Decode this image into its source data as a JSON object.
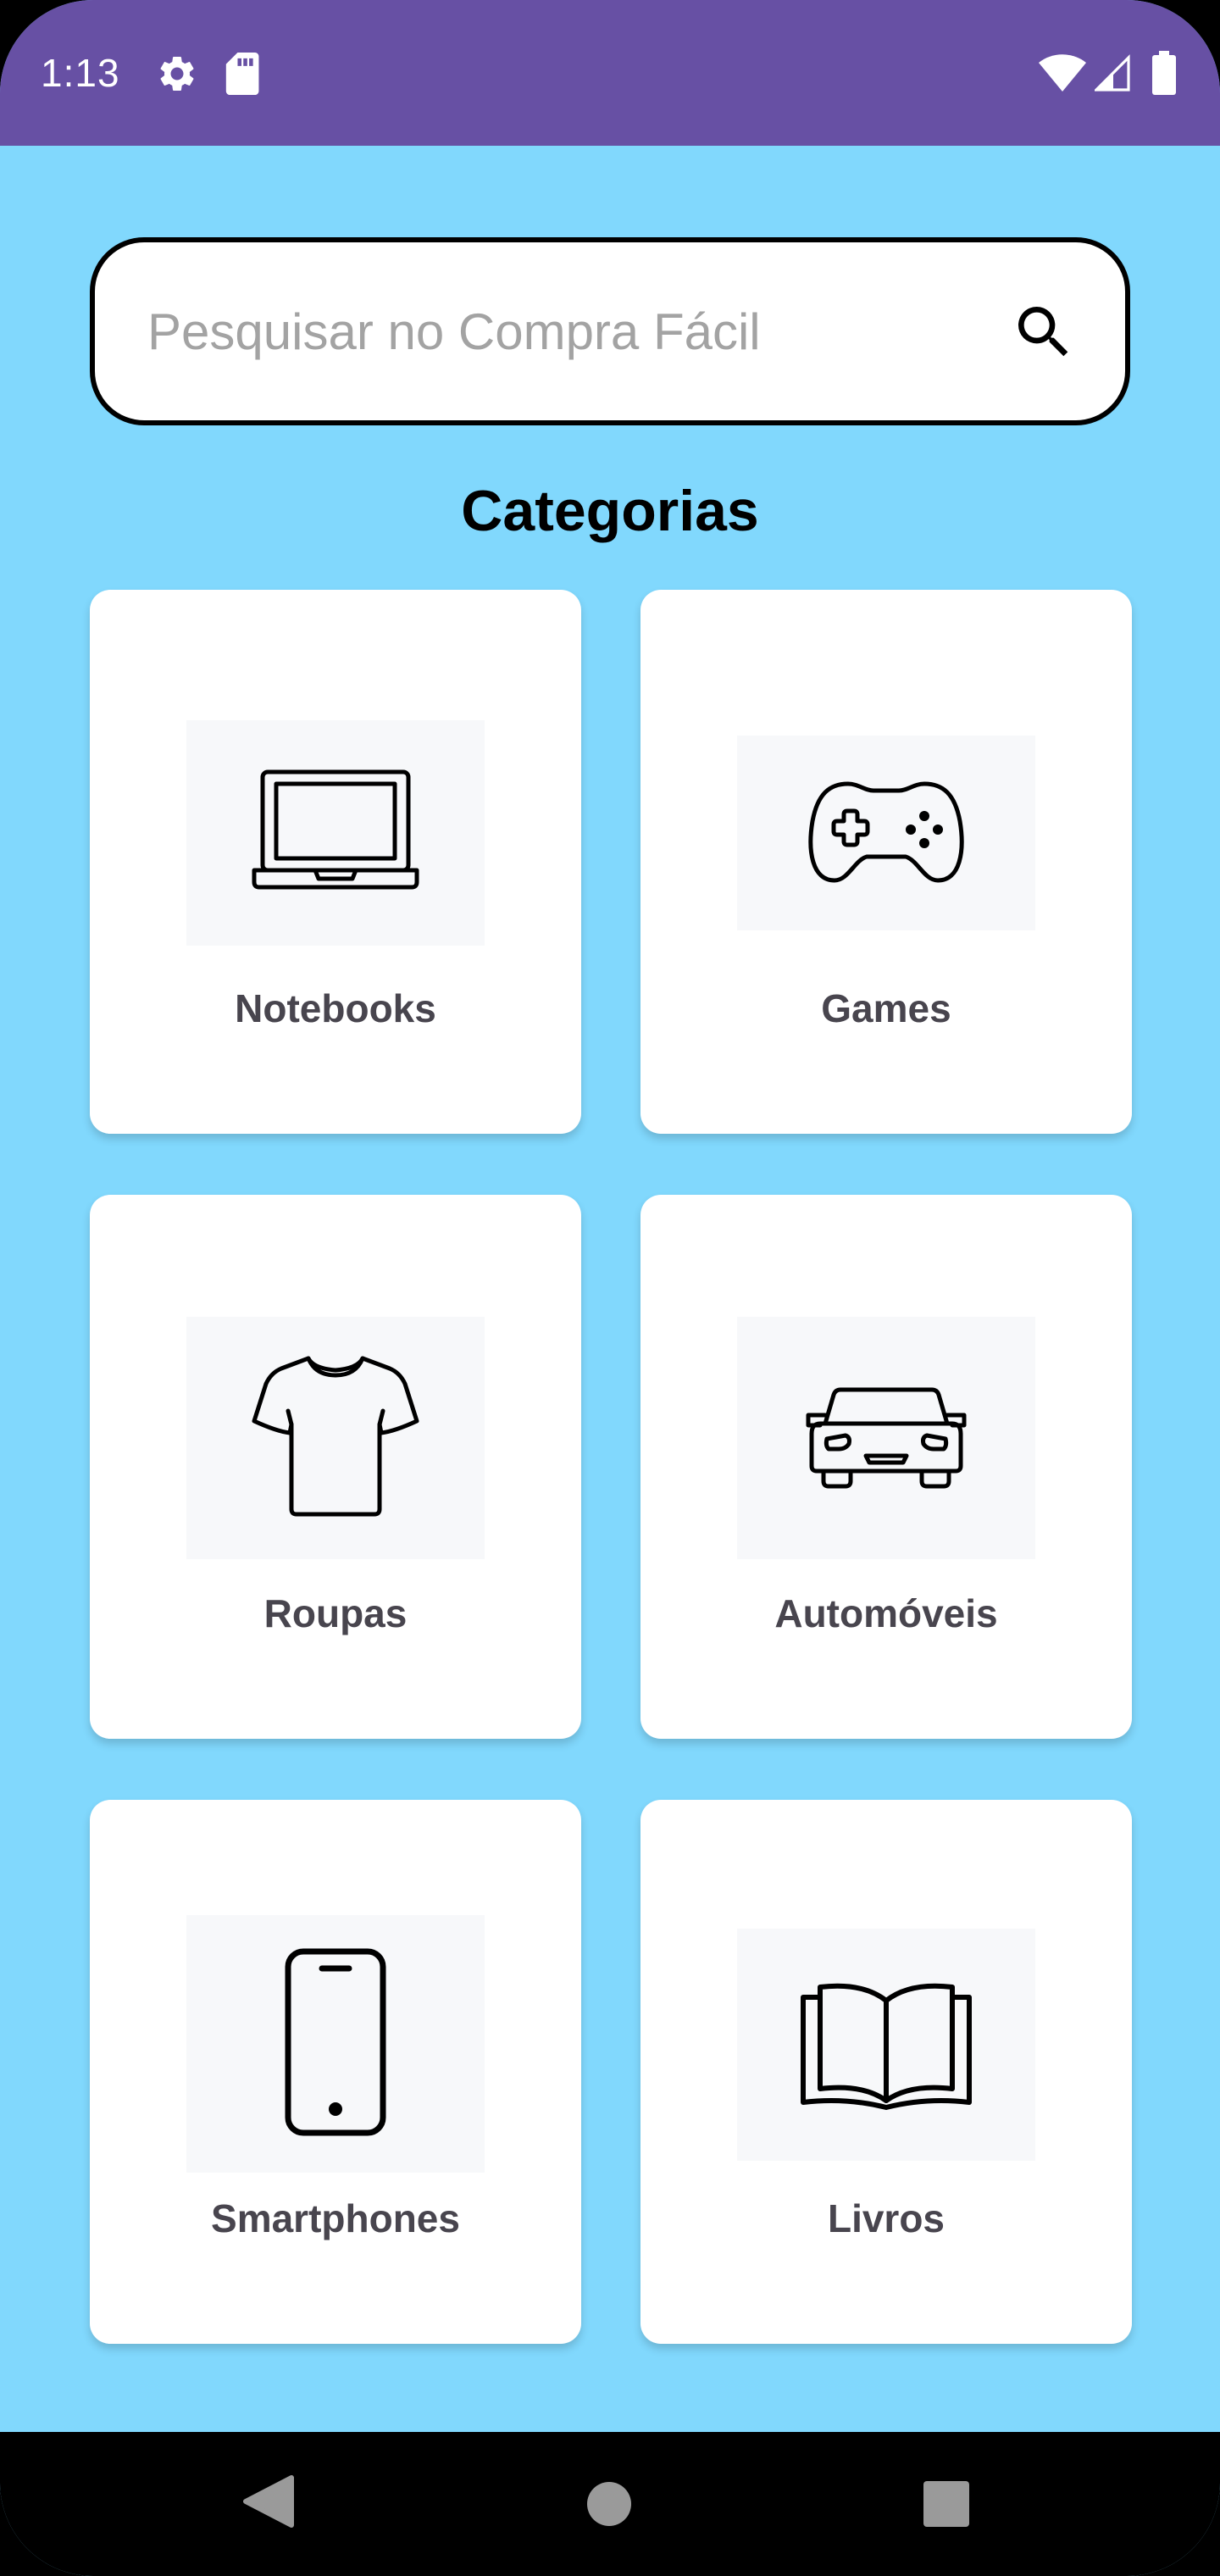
{
  "status_bar": {
    "time": "1:13",
    "icons": [
      "gear-icon",
      "sd-card-icon",
      "wifi-icon",
      "signal-icon",
      "battery-icon"
    ]
  },
  "search": {
    "placeholder": "Pesquisar no Compra Fácil",
    "value": "",
    "icon": "search-icon"
  },
  "page": {
    "title": "Categorias"
  },
  "categories": [
    {
      "label": "Notebooks",
      "icon": "laptop-icon"
    },
    {
      "label": "Games",
      "icon": "gamepad-icon"
    },
    {
      "label": "Roupas",
      "icon": "tshirt-icon"
    },
    {
      "label": "Automóveis",
      "icon": "car-icon"
    },
    {
      "label": "Smartphones",
      "icon": "smartphone-icon"
    },
    {
      "label": "Livros",
      "icon": "book-icon"
    }
  ],
  "nav_bar": {
    "buttons": [
      "back-icon",
      "home-icon",
      "recents-icon"
    ]
  },
  "colors": {
    "status_bar": "#6750a4",
    "background": "#81d8fd",
    "card": "#ffffff",
    "card_label": "#48454e",
    "nav_bar": "#000000"
  }
}
